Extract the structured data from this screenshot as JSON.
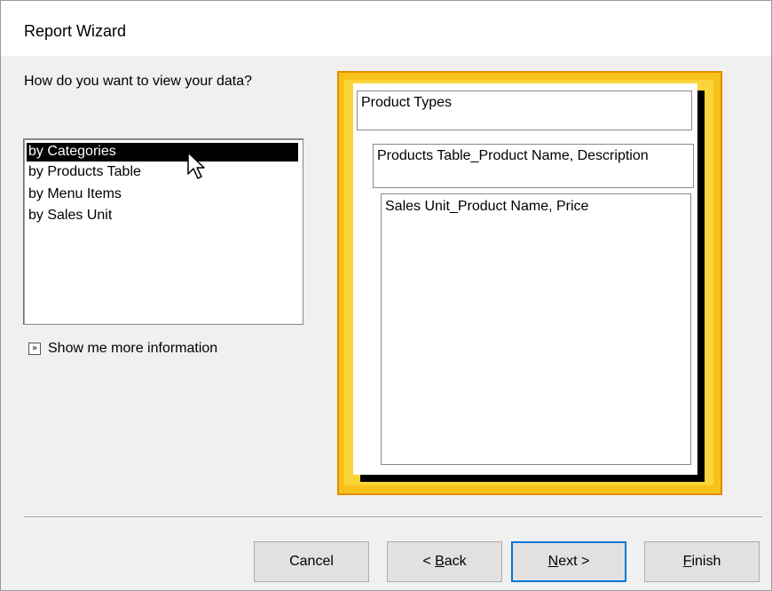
{
  "window": {
    "title": "Report Wizard"
  },
  "question": "How do you want to view your data?",
  "view_list": {
    "items": [
      {
        "label": "by Categories",
        "selected": true
      },
      {
        "label": "by Products Table",
        "selected": false
      },
      {
        "label": "by Menu Items",
        "selected": false
      },
      {
        "label": "by Sales Unit",
        "selected": false
      }
    ]
  },
  "more_info": {
    "label": "Show me more information",
    "icon": "double-chevron-right-icon"
  },
  "preview": {
    "level1": "Product Types",
    "level2": "Products Table_Product Name, Description",
    "detail": "Sales Unit_Product Name, Price",
    "frame_color": "#f7c31a",
    "frame_border_color": "#e58a00"
  },
  "buttons": {
    "cancel": "Cancel",
    "back_prefix": "< ",
    "back_mnemonic": "B",
    "back_rest": "ack",
    "next_mnemonic": "N",
    "next_rest": "ext >",
    "finish_mnemonic": "F",
    "finish_rest": "inish"
  },
  "colors": {
    "accent": "#0078d7",
    "selection": "#000000"
  }
}
